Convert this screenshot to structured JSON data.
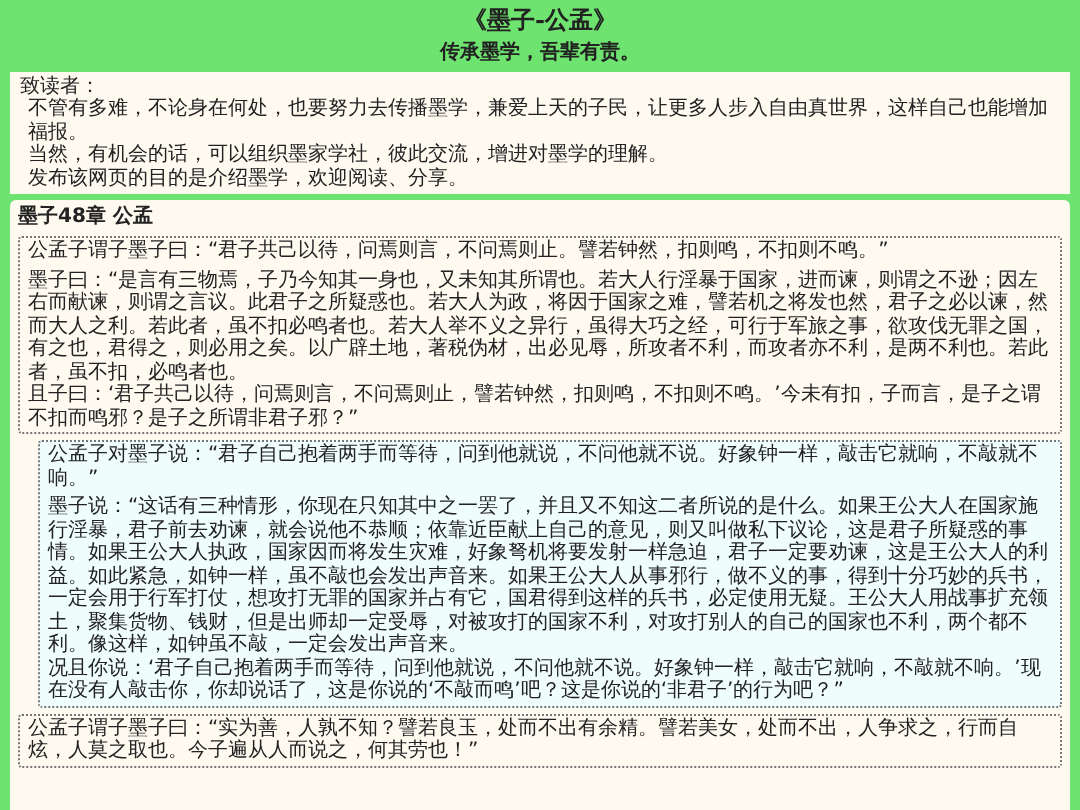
{
  "header": {
    "title": "《墨子-公孟》",
    "subtitle": "传承墨学，吾辈有责。"
  },
  "intro": {
    "greeting": "致读者：",
    "paragraphs": [
      "不管有多难，不论身在何处，也要努力去传播墨学，兼爱上天的子民，让更多人步入自由真世界，这样自己也能增加福报。",
      "当然，有机会的话，可以组织墨家学社，彼此交流，增进对墨学的理解。",
      "发布该网页的目的是介绍墨学，欢迎阅读、分享。"
    ]
  },
  "chapter": {
    "heading": "墨子48章 公孟",
    "sections": [
      {
        "kind": "original",
        "blocks": [
          [
            "公孟子谓子墨子曰：“君子共己以待，问焉则言，不问焉则止。譬若钟然，扣则鸣，不扣则不鸣。”"
          ],
          [
            "墨子曰：“是言有三物焉，子乃今知其一身也，又未知其所谓也。若大人行淫暴于国家，进而谏，则谓之不逊；因左右而献谏，则谓之言议。此君子之所疑惑也。若大人为政，将因于国家之难，譬若机之将发也然，君子之必以谏，然而大人之利。若此者，虽不扣必鸣者也。若大人举不义之异行，虽得大巧之经，可行于军旅之事，欲攻伐无罪之国，有之也，君得之，则必用之矣。以广辟土地，著税伪材，出必见辱，所攻者不利，而攻者亦不利，是两不利也。若此者，虽不扣，必鸣者也。",
            "且子曰：‘君子共己以待，问焉则言，不问焉则止，譬若钟然，扣则鸣，不扣则不鸣。’今未有扣，子而言，是子之谓不扣而鸣邪？是子之所谓非君子邪？”"
          ]
        ]
      },
      {
        "kind": "translation",
        "blocks": [
          [
            "公孟子对墨子说：“君子自己抱着两手而等待，问到他就说，不问他就不说。好象钟一样，敲击它就响，不敲就不响。”"
          ],
          [
            "墨子说：“这话有三种情形，你现在只知其中之一罢了，并且又不知这二者所说的是什么。如果王公大人在国家施行淫暴，君子前去劝谏，就会说他不恭顺；依靠近臣献上自己的意见，则又叫做私下议论，这是君子所疑惑的事情。如果王公大人执政，国家因而将发生灾难，好象弩机将要发射一样急迫，君子一定要劝谏，这是王公大人的利益。如此紧急，如钟一样，虽不敲也会发出声音来。如果王公大人从事邪行，做不义的事，得到十分巧妙的兵书，一定会用于行军打仗，想攻打无罪的国家并占有它，国君得到这样的兵书，必定使用无疑。王公大人用战事扩充领土，聚集货物、钱财，但是出师却一定受辱，对被攻打的国家不利，对攻打别人的自己的国家也不利，两个都不利。像这样，如钟虽不敲，一定会发出声音来。",
            "况且你说：‘君子自己抱着两手而等待，问到他就说，不问他就不说。好象钟一样，敲击它就响，不敲就不响。’现在没有人敲击你，你却说话了，这是你说的‘不敲而鸣’吧？这是你说的‘非君子’的行为吧？”"
          ]
        ]
      },
      {
        "kind": "original",
        "blocks": [
          [
            "公孟子谓子墨子曰：“实为善，人孰不知？譬若良玉，处而不出有余精。譬若美女，处而不出，人争求之，行而自炫，人莫之取也。今子遍从人而说之，何其劳也！”"
          ]
        ]
      }
    ]
  }
}
